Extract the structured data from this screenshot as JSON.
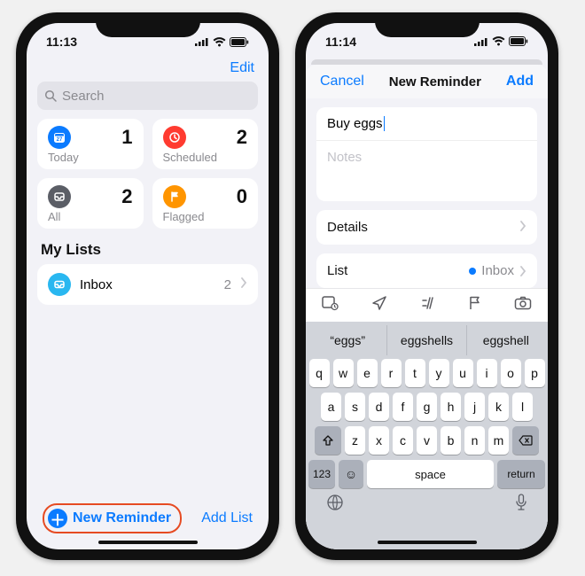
{
  "left": {
    "status_time": "11:13",
    "edit_label": "Edit",
    "search_placeholder": "Search",
    "cards": [
      {
        "label": "Today",
        "count": "1",
        "color": "#0b7bff"
      },
      {
        "label": "Scheduled",
        "count": "2",
        "color": "#ff3b30"
      },
      {
        "label": "All",
        "count": "2",
        "color": "#5b5e66"
      },
      {
        "label": "Flagged",
        "count": "0",
        "color": "#ff9500"
      }
    ],
    "section_title": "My Lists",
    "inbox": {
      "label": "Inbox",
      "count": "2",
      "color": "#29b7f0"
    },
    "new_reminder_label": "New Reminder",
    "add_list_label": "Add List"
  },
  "right": {
    "status_time": "11:14",
    "cancel_label": "Cancel",
    "sheet_title": "New Reminder",
    "add_label": "Add",
    "title_value": "Buy eggs",
    "notes_placeholder": "Notes",
    "details_label": "Details",
    "list_label": "List",
    "list_value": "Inbox",
    "suggestions": [
      "“eggs”",
      "eggshells",
      "eggshell"
    ],
    "keys_r1": [
      "q",
      "w",
      "e",
      "r",
      "t",
      "y",
      "u",
      "i",
      "o",
      "p"
    ],
    "keys_r2": [
      "a",
      "s",
      "d",
      "f",
      "g",
      "h",
      "j",
      "k",
      "l"
    ],
    "keys_r3": [
      "z",
      "x",
      "c",
      "v",
      "b",
      "n",
      "m"
    ],
    "key_123": "123",
    "key_space": "space",
    "key_return": "return"
  }
}
